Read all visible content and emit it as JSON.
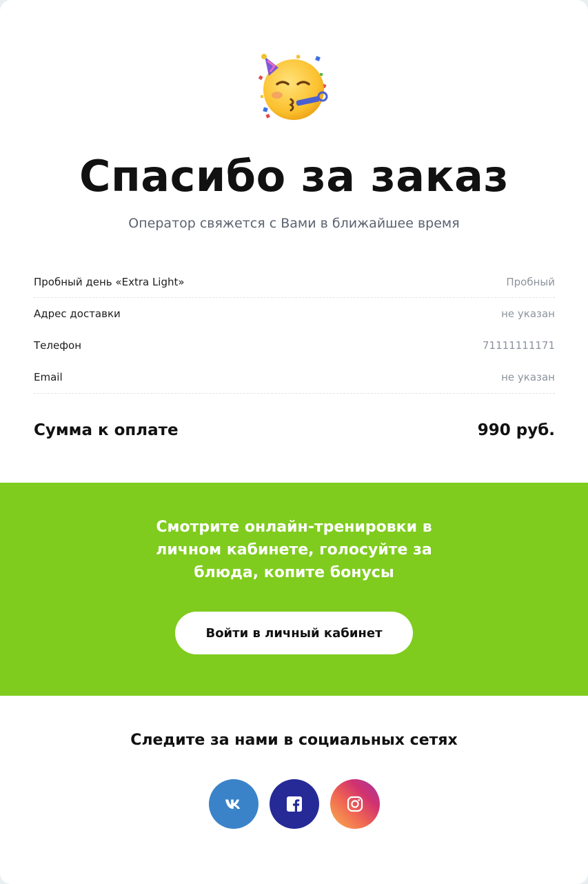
{
  "header": {
    "emoji_icon": "partying-face-icon",
    "title": "Спасибо за заказ",
    "subtitle": "Оператор свяжется с Вами в ближайшее время"
  },
  "order": {
    "rows": [
      {
        "label": "Пробный день «Extra Light»",
        "value": "Пробный"
      },
      {
        "label": "Адрес доставки",
        "value": "не указан"
      },
      {
        "label": "Телефон",
        "value": "71111111171"
      },
      {
        "label": "Email",
        "value": "не указан"
      }
    ],
    "total_label": "Сумма к оплате",
    "total_value": "990 руб."
  },
  "promo": {
    "text": "Смотрите онлайн-тренировки в личном кабинете, голосуйте за блюда, копите бонусы",
    "button_label": "Войти в личный кабинет",
    "background": "#7fcc1e"
  },
  "social": {
    "title": "Следите за нами в социальных сетях",
    "links": [
      {
        "icon": "vk-icon",
        "color": "#3a83c9"
      },
      {
        "icon": "facebook-icon",
        "color": "#262a96"
      },
      {
        "icon": "instagram-icon",
        "color": "#e1306c"
      }
    ]
  }
}
